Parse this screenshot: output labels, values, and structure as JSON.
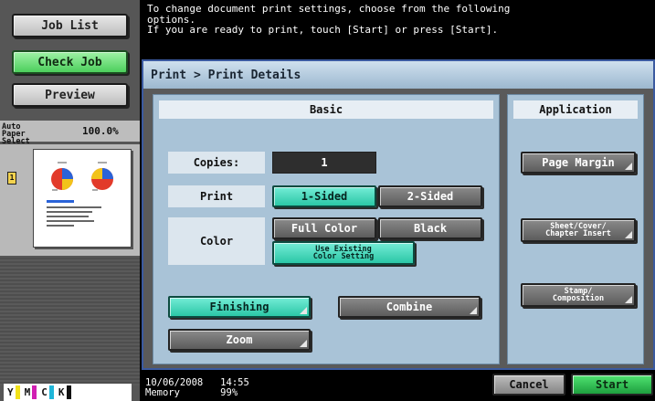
{
  "sidebar": {
    "job_list": "Job List",
    "check_job": "Check Job",
    "preview": "Preview",
    "paper_select": "Auto Paper\nSelect",
    "zoom": "100.0%",
    "page_count": "1",
    "toner": [
      "Y",
      "M",
      "C",
      "K"
    ],
    "toner_colors": [
      "#f2e21a",
      "#d11fb2",
      "#1fb6d9",
      "#111111"
    ]
  },
  "message": "To change document print settings, choose from the following\noptions.\nIf you are ready to print, touch [Start] or press [Start].",
  "breadcrumb": "Print > Print Details",
  "basic": {
    "title": "Basic",
    "copies_label": "Copies:",
    "copies_value": "1",
    "print_label": "Print",
    "one_sided": "1-Sided",
    "two_sided": "2-Sided",
    "color_label": "Color",
    "full_color": "Full Color",
    "black": "Black",
    "use_existing": "Use Existing\nColor Setting",
    "finishing": "Finishing",
    "combine": "Combine",
    "zoom": "Zoom"
  },
  "application": {
    "title": "Application",
    "page_margin": "Page Margin",
    "sheet_cover": "Sheet/Cover/\nChapter Insert",
    "stamp": "Stamp/\nComposition"
  },
  "status": {
    "datetime": "10/06/2008   14:55\nMemory       99%"
  },
  "footer": {
    "cancel": "Cancel",
    "start": "Start"
  }
}
